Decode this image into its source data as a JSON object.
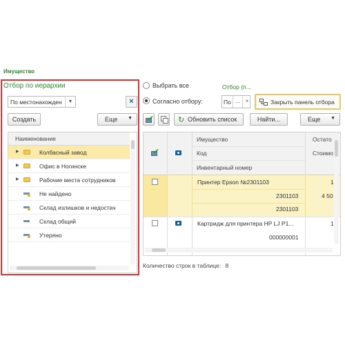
{
  "page_title": "Имущество",
  "hierarchy_panel": {
    "header": "Отбор по иерархии",
    "grouping_select": "По местонахожден",
    "create_label": "Создать",
    "more_label": "Еще",
    "column_header": "Наименование",
    "items": [
      {
        "label": "Колбасный завод",
        "type": "folder",
        "selected": true
      },
      {
        "label": "Офис в Ногинске",
        "type": "folder"
      },
      {
        "label": "Рабочие места сотрудников",
        "type": "folder"
      },
      {
        "label": "Не найдено",
        "type": "item"
      },
      {
        "label": "Склад излишков и недостач",
        "type": "item"
      },
      {
        "label": "Склад общий",
        "type": "item"
      },
      {
        "label": "Утеряно",
        "type": "item"
      }
    ]
  },
  "filter": {
    "select_all_label": "Выбрать все",
    "by_filter_label": "Согласно отбору:",
    "filter_link": "Отбор (п...",
    "field_value": "По",
    "field_dots": "...",
    "field_clear": "×",
    "close_panel_label": "Закрыть панель отбора"
  },
  "toolbar": {
    "refresh_label": "Обновить список",
    "find_label": "Найти...",
    "more_label": "Еще"
  },
  "table": {
    "headers": {
      "item": "Имущество",
      "code": "Код",
      "inventory_number": "Инвентарный номер",
      "balance": "Остато",
      "cost": "Стоимо"
    },
    "rows": [
      {
        "name": "Принтер Epson №2301103",
        "code": "2301103",
        "inventory_number": "2301103",
        "balance": "1",
        "cost": "4 50"
      },
      {
        "name": "Картридж для принтера HP LJ P1...",
        "code": "000000001",
        "inventory_number": "",
        "balance": "1",
        "cost": ""
      }
    ]
  },
  "row_count": {
    "label": "Количество строк в таблице:",
    "value": "8"
  }
}
